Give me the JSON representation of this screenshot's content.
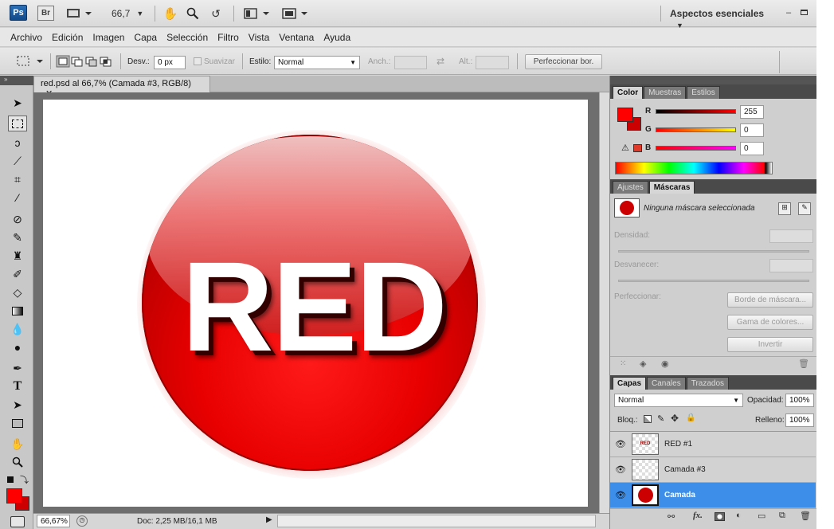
{
  "appbar": {
    "ps": "Ps",
    "br": "Br",
    "zoom": "66,7",
    "workspace": "Aspectos esenciales"
  },
  "menu": [
    "Archivo",
    "Edición",
    "Imagen",
    "Capa",
    "Selección",
    "Filtro",
    "Vista",
    "Ventana",
    "Ayuda"
  ],
  "options": {
    "feather_label": "Desv.:",
    "feather_value": "0 px",
    "antialias_label": "Suavizar",
    "style_label": "Estilo:",
    "style_value": "Normal",
    "width_label": "Anch.:",
    "height_label": "Alt.:",
    "refine_edge": "Perfeccionar bor."
  },
  "document": {
    "tab": "red.psd al 66,7% (Camada #3, RGB/8)",
    "canvas_text": "RED",
    "zoom": "66,67%",
    "doc_info": "Doc: 2,25 MB/16,1 MB"
  },
  "colors": {
    "foreground": "#ff0000",
    "background": "#cc0000",
    "button": "#dd0000",
    "selected": "#3d8ee8"
  },
  "color_panel": {
    "tabs": [
      "Color",
      "Muestras",
      "Estilos"
    ],
    "r_label": "R",
    "g_label": "G",
    "b_label": "B",
    "r": "255",
    "g": "0",
    "b": "0"
  },
  "masks_panel": {
    "tabs": [
      "Ajustes",
      "Máscaras"
    ],
    "status": "Ninguna máscara seleccionada",
    "density": "Densidad:",
    "feather": "Desvanecer:",
    "refine": "Perfeccionar:",
    "mask_edge": "Borde de máscara...",
    "color_range": "Gama de colores...",
    "invert": "Invertir"
  },
  "layers_panel": {
    "tabs": [
      "Capas",
      "Canales",
      "Trazados"
    ],
    "blend": "Normal",
    "opacity_label": "Opacidad:",
    "opacity": "100%",
    "lock_label": "Bloq.:",
    "fill_label": "Relleno:",
    "fill": "100%",
    "layers": [
      {
        "name": "RED #1",
        "thumb": "RED"
      },
      {
        "name": "Camada #3"
      },
      {
        "name": "Camada"
      }
    ]
  }
}
